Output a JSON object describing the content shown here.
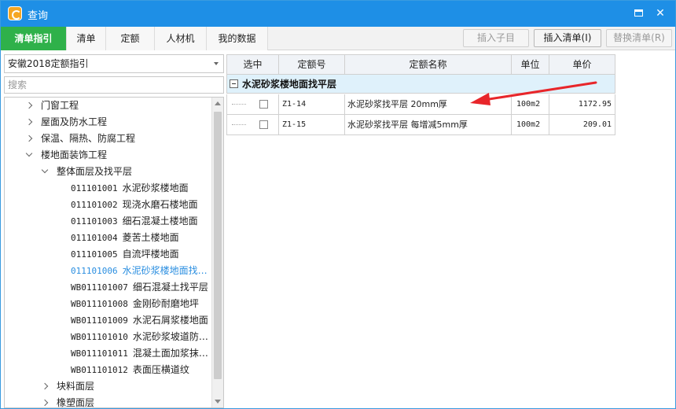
{
  "window": {
    "title": "查询"
  },
  "tabs": [
    "清单指引",
    "清单",
    "定额",
    "人材机",
    "我的数据"
  ],
  "toolbar": {
    "insert_child": "插入子目",
    "insert_list": "插入清单(I)",
    "replace_list": "替换清单(R)"
  },
  "left": {
    "dropdown_value": "安徽2018定额指引",
    "search_placeholder": "搜索"
  },
  "tree": [
    {
      "level": 1,
      "toggle": "right",
      "code": "",
      "label": "门窗工程"
    },
    {
      "level": 1,
      "toggle": "right",
      "code": "",
      "label": "屋面及防水工程"
    },
    {
      "level": 1,
      "toggle": "right",
      "code": "",
      "label": "保温、隔热、防腐工程"
    },
    {
      "level": 1,
      "toggle": "down",
      "code": "",
      "label": "楼地面装饰工程"
    },
    {
      "level": 2,
      "toggle": "down",
      "code": "",
      "label": "整体面层及找平层"
    },
    {
      "level": 3,
      "toggle": "",
      "code": "011101001",
      "label": "水泥砂浆楼地面"
    },
    {
      "level": 3,
      "toggle": "",
      "code": "011101002",
      "label": "现浇水磨石楼地面"
    },
    {
      "level": 3,
      "toggle": "",
      "code": "011101003",
      "label": "细石混凝土楼地面"
    },
    {
      "level": 3,
      "toggle": "",
      "code": "011101004",
      "label": "菱苦土楼地面"
    },
    {
      "level": 3,
      "toggle": "",
      "code": "011101005",
      "label": "自流坪楼地面"
    },
    {
      "level": 3,
      "toggle": "",
      "code": "011101006",
      "label": "水泥砂浆楼地面找…",
      "selected": true
    },
    {
      "level": 3,
      "toggle": "",
      "code": "WB011101007",
      "label": "细石混凝土找平层"
    },
    {
      "level": 3,
      "toggle": "",
      "code": "WB011101008",
      "label": "金刚砂耐磨地坪"
    },
    {
      "level": 3,
      "toggle": "",
      "code": "WB011101009",
      "label": "水泥石屑浆楼地面"
    },
    {
      "level": 3,
      "toggle": "",
      "code": "WB011101010",
      "label": "水泥砂浆坡道防…"
    },
    {
      "level": 3,
      "toggle": "",
      "code": "WB011101011",
      "label": "混凝土面加浆抹…"
    },
    {
      "level": 3,
      "toggle": "",
      "code": "WB011101012",
      "label": "表面压横道纹"
    },
    {
      "level": 2,
      "toggle": "right",
      "code": "",
      "label": "块料面层"
    },
    {
      "level": 2,
      "toggle": "right",
      "code": "",
      "label": "橡塑面层"
    }
  ],
  "grid": {
    "headers": [
      "选中",
      "定额号",
      "定额名称",
      "单位",
      "单价"
    ],
    "group_title": "水泥砂浆楼地面找平层",
    "rows": [
      {
        "code": "Z1-14",
        "name": "水泥砂浆找平层 20mm厚",
        "unit": "100m2",
        "price": "1172.95"
      },
      {
        "code": "Z1-15",
        "name": "水泥砂浆找平层 每增减5mm厚",
        "unit": "100m2",
        "price": "209.01"
      }
    ]
  },
  "colors": {
    "titlebar": "#1e8fe6",
    "active_tab": "#2fb14a",
    "group_row": "#dff1fb",
    "annotation_arrow": "#e8262a",
    "selected_text": "#2a8ee0"
  }
}
